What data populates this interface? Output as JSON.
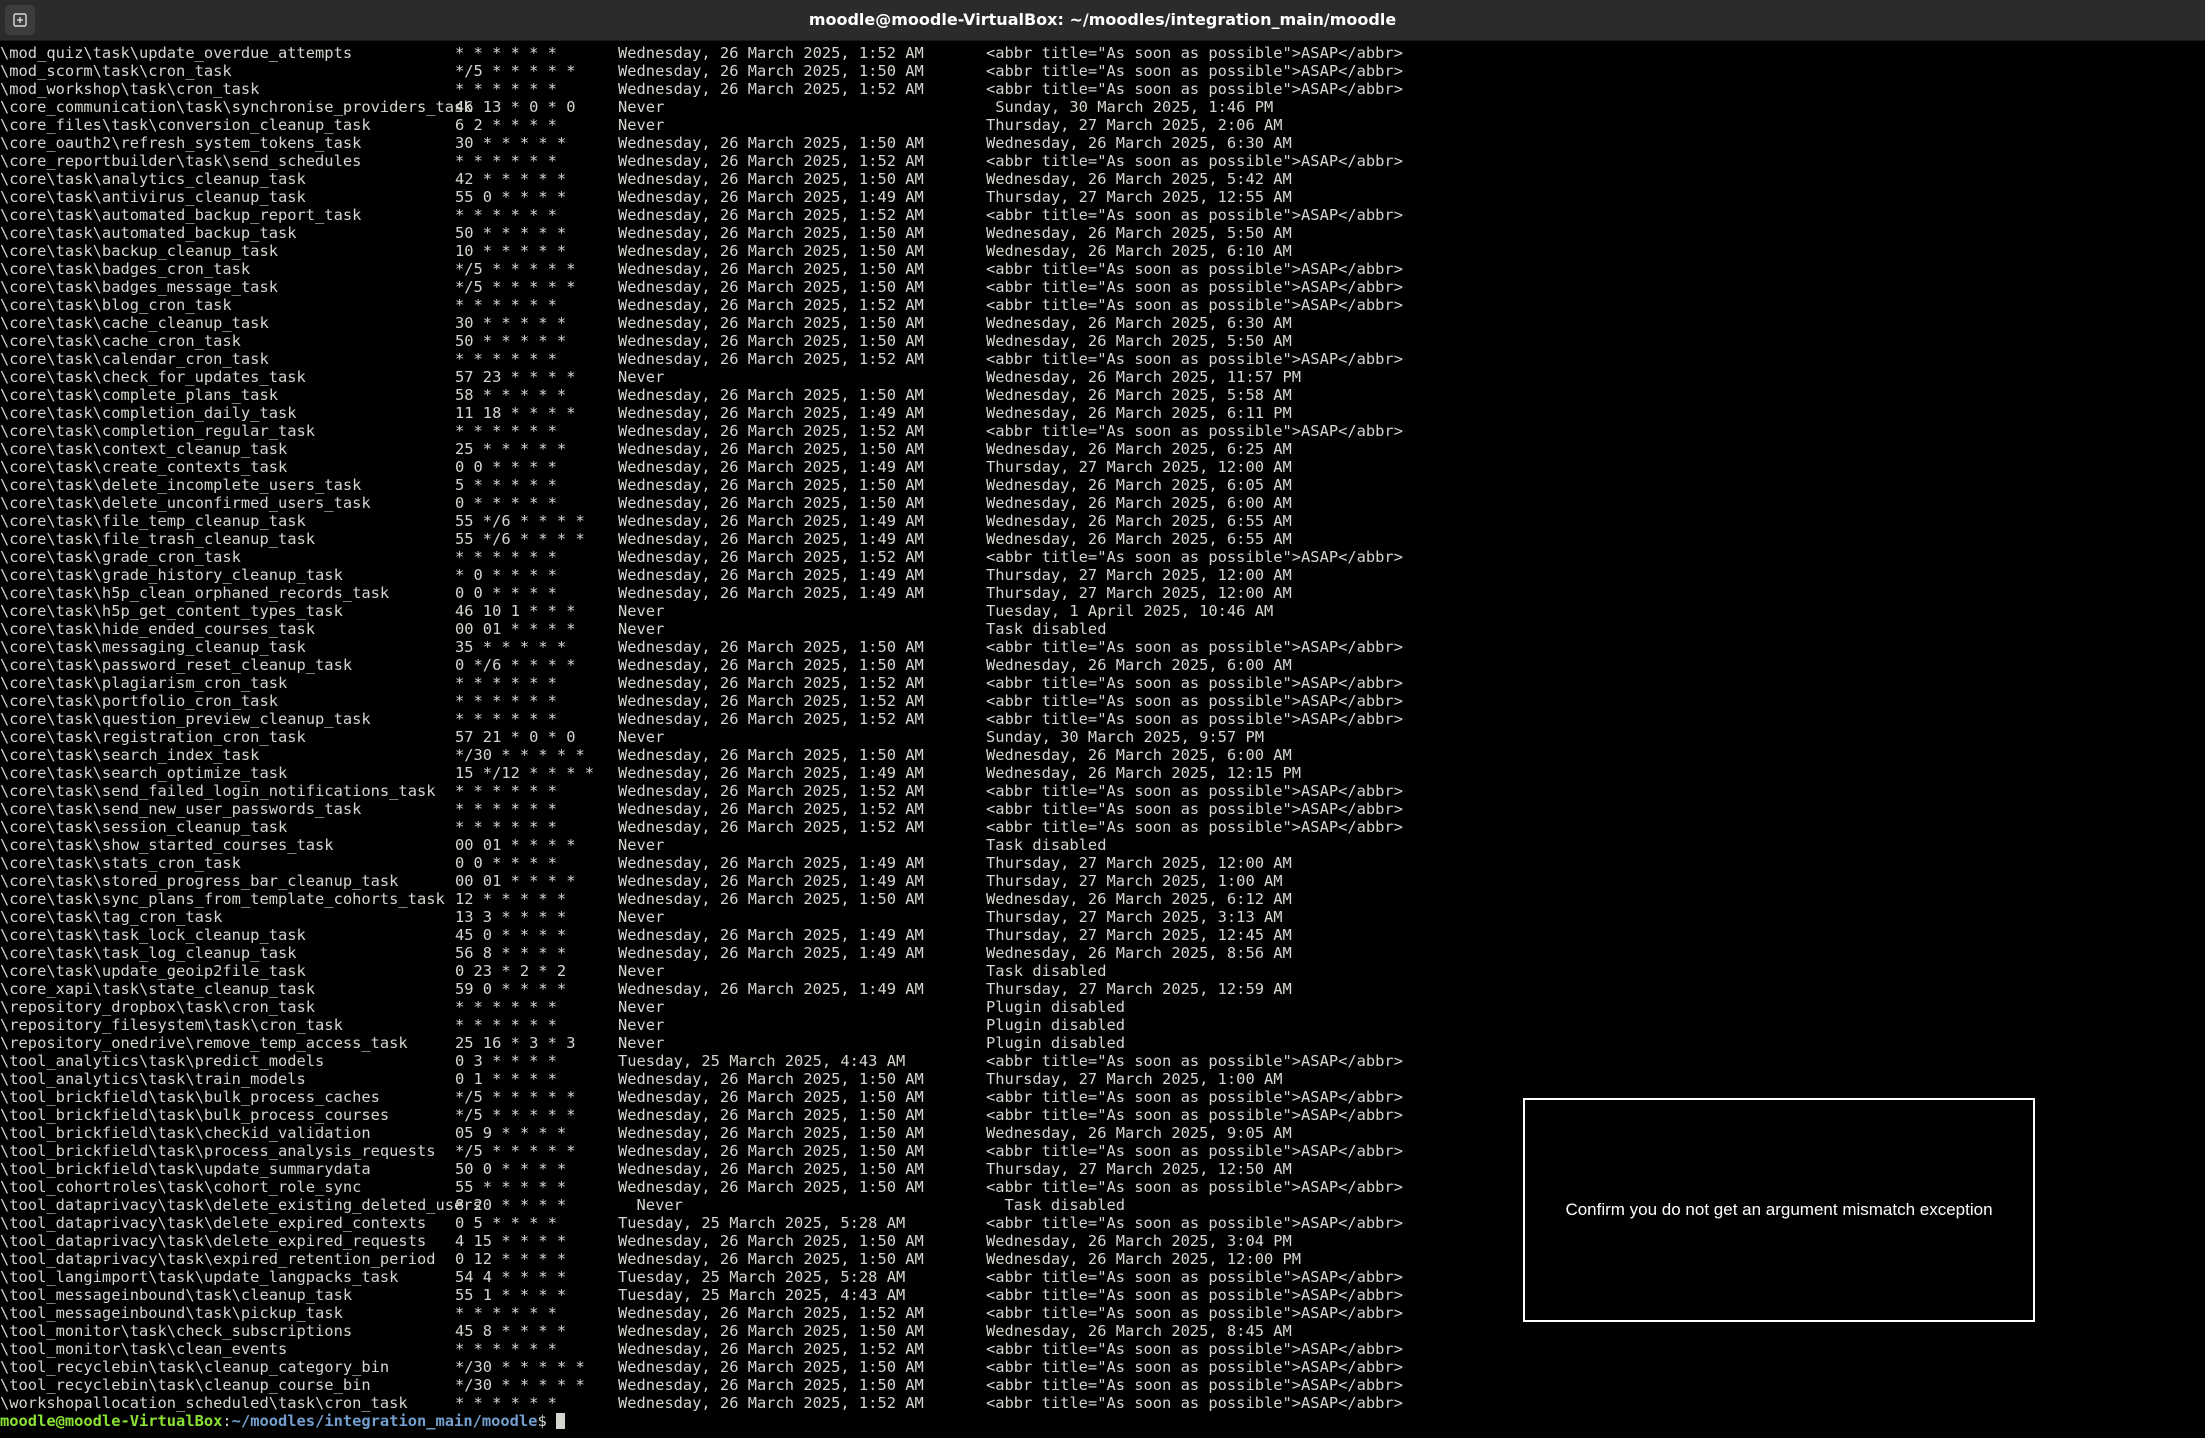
{
  "window": {
    "title": "moodle@moodle-VirtualBox: ~/moodles/integration_main/moodle",
    "new_tab_icon": "new-tab-icon"
  },
  "rows": [
    [
      "\\mod_quiz\\task\\update_overdue_attempts",
      "* * * * * *",
      "Wednesday, 26 March 2025, 1:52 AM",
      "<abbr title=\"As soon as possible\">ASAP</abbr>"
    ],
    [
      "\\mod_scorm\\task\\cron_task",
      "*/5 * * * * *",
      "Wednesday, 26 March 2025, 1:50 AM",
      "<abbr title=\"As soon as possible\">ASAP</abbr>"
    ],
    [
      "\\mod_workshop\\task\\cron_task",
      "* * * * * *",
      "Wednesday, 26 March 2025, 1:52 AM",
      "<abbr title=\"As soon as possible\">ASAP</abbr>"
    ],
    [
      "\\core_communication\\task\\synchronise_providers_task",
      "46 13 * 0 * 0",
      "Never",
      " Sunday, 30 March 2025, 1:46 PM"
    ],
    [
      "\\core_files\\task\\conversion_cleanup_task",
      "6 2 * * * *",
      "Never",
      "Thursday, 27 March 2025, 2:06 AM"
    ],
    [
      "\\core_oauth2\\refresh_system_tokens_task",
      "30 * * * * *",
      "Wednesday, 26 March 2025, 1:50 AM",
      "Wednesday, 26 March 2025, 6:30 AM"
    ],
    [
      "\\core_reportbuilder\\task\\send_schedules",
      "* * * * * *",
      "Wednesday, 26 March 2025, 1:52 AM",
      "<abbr title=\"As soon as possible\">ASAP</abbr>"
    ],
    [
      "\\core\\task\\analytics_cleanup_task",
      "42 * * * * *",
      "Wednesday, 26 March 2025, 1:50 AM",
      "Wednesday, 26 March 2025, 5:42 AM"
    ],
    [
      "\\core\\task\\antivirus_cleanup_task",
      "55 0 * * * *",
      "Wednesday, 26 March 2025, 1:49 AM",
      "Thursday, 27 March 2025, 12:55 AM"
    ],
    [
      "\\core\\task\\automated_backup_report_task",
      "* * * * * *",
      "Wednesday, 26 March 2025, 1:52 AM",
      "<abbr title=\"As soon as possible\">ASAP</abbr>"
    ],
    [
      "\\core\\task\\automated_backup_task",
      "50 * * * * *",
      "Wednesday, 26 March 2025, 1:50 AM",
      "Wednesday, 26 March 2025, 5:50 AM"
    ],
    [
      "\\core\\task\\backup_cleanup_task",
      "10 * * * * *",
      "Wednesday, 26 March 2025, 1:50 AM",
      "Wednesday, 26 March 2025, 6:10 AM"
    ],
    [
      "\\core\\task\\badges_cron_task",
      "*/5 * * * * *",
      "Wednesday, 26 March 2025, 1:50 AM",
      "<abbr title=\"As soon as possible\">ASAP</abbr>"
    ],
    [
      "\\core\\task\\badges_message_task",
      "*/5 * * * * *",
      "Wednesday, 26 March 2025, 1:50 AM",
      "<abbr title=\"As soon as possible\">ASAP</abbr>"
    ],
    [
      "\\core\\task\\blog_cron_task",
      "* * * * * *",
      "Wednesday, 26 March 2025, 1:52 AM",
      "<abbr title=\"As soon as possible\">ASAP</abbr>"
    ],
    [
      "\\core\\task\\cache_cleanup_task",
      "30 * * * * *",
      "Wednesday, 26 March 2025, 1:50 AM",
      "Wednesday, 26 March 2025, 6:30 AM"
    ],
    [
      "\\core\\task\\cache_cron_task",
      "50 * * * * *",
      "Wednesday, 26 March 2025, 1:50 AM",
      "Wednesday, 26 March 2025, 5:50 AM"
    ],
    [
      "\\core\\task\\calendar_cron_task",
      "* * * * * *",
      "Wednesday, 26 March 2025, 1:52 AM",
      "<abbr title=\"As soon as possible\">ASAP</abbr>"
    ],
    [
      "\\core\\task\\check_for_updates_task",
      "57 23 * * * *",
      "Never",
      "Wednesday, 26 March 2025, 11:57 PM"
    ],
    [
      "\\core\\task\\complete_plans_task",
      "58 * * * * *",
      "Wednesday, 26 March 2025, 1:50 AM",
      "Wednesday, 26 March 2025, 5:58 AM"
    ],
    [
      "\\core\\task\\completion_daily_task",
      "11 18 * * * *",
      "Wednesday, 26 March 2025, 1:49 AM",
      "Wednesday, 26 March 2025, 6:11 PM"
    ],
    [
      "\\core\\task\\completion_regular_task",
      "* * * * * *",
      "Wednesday, 26 March 2025, 1:52 AM",
      "<abbr title=\"As soon as possible\">ASAP</abbr>"
    ],
    [
      "\\core\\task\\context_cleanup_task",
      "25 * * * * *",
      "Wednesday, 26 March 2025, 1:50 AM",
      "Wednesday, 26 March 2025, 6:25 AM"
    ],
    [
      "\\core\\task\\create_contexts_task",
      "0 0 * * * *",
      "Wednesday, 26 March 2025, 1:49 AM",
      "Thursday, 27 March 2025, 12:00 AM"
    ],
    [
      "\\core\\task\\delete_incomplete_users_task",
      "5 * * * * *",
      "Wednesday, 26 March 2025, 1:50 AM",
      "Wednesday, 26 March 2025, 6:05 AM"
    ],
    [
      "\\core\\task\\delete_unconfirmed_users_task",
      "0 * * * * *",
      "Wednesday, 26 March 2025, 1:50 AM",
      "Wednesday, 26 March 2025, 6:00 AM"
    ],
    [
      "\\core\\task\\file_temp_cleanup_task",
      "55 */6 * * * *",
      "Wednesday, 26 March 2025, 1:49 AM",
      "Wednesday, 26 March 2025, 6:55 AM"
    ],
    [
      "\\core\\task\\file_trash_cleanup_task",
      "55 */6 * * * *",
      "Wednesday, 26 March 2025, 1:49 AM",
      "Wednesday, 26 March 2025, 6:55 AM"
    ],
    [
      "\\core\\task\\grade_cron_task",
      "* * * * * *",
      "Wednesday, 26 March 2025, 1:52 AM",
      "<abbr title=\"As soon as possible\">ASAP</abbr>"
    ],
    [
      "\\core\\task\\grade_history_cleanup_task",
      "* 0 * * * *",
      "Wednesday, 26 March 2025, 1:49 AM",
      "Thursday, 27 March 2025, 12:00 AM"
    ],
    [
      "\\core\\task\\h5p_clean_orphaned_records_task",
      "0 0 * * * *",
      "Wednesday, 26 March 2025, 1:49 AM",
      "Thursday, 27 March 2025, 12:00 AM"
    ],
    [
      "\\core\\task\\h5p_get_content_types_task",
      "46 10 1 * * *",
      "Never",
      "Tuesday, 1 April 2025, 10:46 AM"
    ],
    [
      "\\core\\task\\hide_ended_courses_task",
      "00 01 * * * *",
      "Never",
      "Task disabled"
    ],
    [
      "\\core\\task\\messaging_cleanup_task",
      "35 * * * * *",
      "Wednesday, 26 March 2025, 1:50 AM",
      "<abbr title=\"As soon as possible\">ASAP</abbr>"
    ],
    [
      "\\core\\task\\password_reset_cleanup_task",
      "0 */6 * * * *",
      "Wednesday, 26 March 2025, 1:50 AM",
      "Wednesday, 26 March 2025, 6:00 AM"
    ],
    [
      "\\core\\task\\plagiarism_cron_task",
      "* * * * * *",
      "Wednesday, 26 March 2025, 1:52 AM",
      "<abbr title=\"As soon as possible\">ASAP</abbr>"
    ],
    [
      "\\core\\task\\portfolio_cron_task",
      "* * * * * *",
      "Wednesday, 26 March 2025, 1:52 AM",
      "<abbr title=\"As soon as possible\">ASAP</abbr>"
    ],
    [
      "\\core\\task\\question_preview_cleanup_task",
      "* * * * * *",
      "Wednesday, 26 March 2025, 1:52 AM",
      "<abbr title=\"As soon as possible\">ASAP</abbr>"
    ],
    [
      "\\core\\task\\registration_cron_task",
      "57 21 * 0 * 0",
      "Never",
      "Sunday, 30 March 2025, 9:57 PM"
    ],
    [
      "\\core\\task\\search_index_task",
      "*/30 * * * * *",
      "Wednesday, 26 March 2025, 1:50 AM",
      "Wednesday, 26 March 2025, 6:00 AM"
    ],
    [
      "\\core\\task\\search_optimize_task",
      "15 */12 * * * *",
      "Wednesday, 26 March 2025, 1:49 AM",
      "Wednesday, 26 March 2025, 12:15 PM"
    ],
    [
      "\\core\\task\\send_failed_login_notifications_task",
      "* * * * * *",
      "Wednesday, 26 March 2025, 1:52 AM",
      "<abbr title=\"As soon as possible\">ASAP</abbr>"
    ],
    [
      "\\core\\task\\send_new_user_passwords_task",
      "* * * * * *",
      "Wednesday, 26 March 2025, 1:52 AM",
      "<abbr title=\"As soon as possible\">ASAP</abbr>"
    ],
    [
      "\\core\\task\\session_cleanup_task",
      "* * * * * *",
      "Wednesday, 26 March 2025, 1:52 AM",
      "<abbr title=\"As soon as possible\">ASAP</abbr>"
    ],
    [
      "\\core\\task\\show_started_courses_task",
      "00 01 * * * *",
      "Never",
      "Task disabled"
    ],
    [
      "\\core\\task\\stats_cron_task",
      "0 0 * * * *",
      "Wednesday, 26 March 2025, 1:49 AM",
      "Thursday, 27 March 2025, 12:00 AM"
    ],
    [
      "\\core\\task\\stored_progress_bar_cleanup_task",
      "00 01 * * * *",
      "Wednesday, 26 March 2025, 1:49 AM",
      "Thursday, 27 March 2025, 1:00 AM"
    ],
    [
      "\\core\\task\\sync_plans_from_template_cohorts_task",
      "12 * * * * *",
      "Wednesday, 26 March 2025, 1:50 AM",
      "Wednesday, 26 March 2025, 6:12 AM"
    ],
    [
      "\\core\\task\\tag_cron_task",
      "13 3 * * * *",
      "Never",
      "Thursday, 27 March 2025, 3:13 AM"
    ],
    [
      "\\core\\task\\task_lock_cleanup_task",
      "45 0 * * * *",
      "Wednesday, 26 March 2025, 1:49 AM",
      "Thursday, 27 March 2025, 12:45 AM"
    ],
    [
      "\\core\\task\\task_log_cleanup_task",
      "56 8 * * * *",
      "Wednesday, 26 March 2025, 1:49 AM",
      "Wednesday, 26 March 2025, 8:56 AM"
    ],
    [
      "\\core\\task\\update_geoip2file_task",
      "0 23 * 2 * 2",
      "Never",
      "Task disabled"
    ],
    [
      "\\core_xapi\\task\\state_cleanup_task",
      "59 0 * * * *",
      "Wednesday, 26 March 2025, 1:49 AM",
      "Thursday, 27 March 2025, 12:59 AM"
    ],
    [
      "\\repository_dropbox\\task\\cron_task",
      "* * * * * *",
      "Never",
      "Plugin disabled"
    ],
    [
      "\\repository_filesystem\\task\\cron_task",
      "* * * * * *",
      "Never",
      "Plugin disabled"
    ],
    [
      "\\repository_onedrive\\remove_temp_access_task",
      "25 16 * 3 * 3",
      "Never",
      "Plugin disabled"
    ],
    [
      "\\tool_analytics\\task\\predict_models",
      "0 3 * * * *",
      "Tuesday, 25 March 2025, 4:43 AM",
      "<abbr title=\"As soon as possible\">ASAP</abbr>"
    ],
    [
      "\\tool_analytics\\task\\train_models",
      "0 1 * * * *",
      "Wednesday, 26 March 2025, 1:50 AM",
      "Thursday, 27 March 2025, 1:00 AM"
    ],
    [
      "\\tool_brickfield\\task\\bulk_process_caches",
      "*/5 * * * * *",
      "Wednesday, 26 March 2025, 1:50 AM",
      "<abbr title=\"As soon as possible\">ASAP</abbr>"
    ],
    [
      "\\tool_brickfield\\task\\bulk_process_courses",
      "*/5 * * * * *",
      "Wednesday, 26 March 2025, 1:50 AM",
      "<abbr title=\"As soon as possible\">ASAP</abbr>"
    ],
    [
      "\\tool_brickfield\\task\\checkid_validation",
      "05 9 * * * *",
      "Wednesday, 26 March 2025, 1:50 AM",
      "Wednesday, 26 March 2025, 9:05 AM"
    ],
    [
      "\\tool_brickfield\\task\\process_analysis_requests",
      "*/5 * * * * *",
      "Wednesday, 26 March 2025, 1:50 AM",
      "<abbr title=\"As soon as possible\">ASAP</abbr>"
    ],
    [
      "\\tool_brickfield\\task\\update_summarydata",
      "50 0 * * * *",
      "Wednesday, 26 March 2025, 1:50 AM",
      "Thursday, 27 March 2025, 12:50 AM"
    ],
    [
      "\\tool_cohortroles\\task\\cohort_role_sync",
      "55 * * * * *",
      "Wednesday, 26 March 2025, 1:50 AM",
      "<abbr title=\"As soon as possible\">ASAP</abbr>"
    ],
    [
      "\\tool_dataprivacy\\task\\delete_existing_deleted_users",
      "8 20 * * * *",
      "  Never",
      "  Task disabled"
    ],
    [
      "\\tool_dataprivacy\\task\\delete_expired_contexts",
      "0 5 * * * *",
      "Tuesday, 25 March 2025, 5:28 AM",
      "<abbr title=\"As soon as possible\">ASAP</abbr>"
    ],
    [
      "\\tool_dataprivacy\\task\\delete_expired_requests",
      "4 15 * * * *",
      "Wednesday, 26 March 2025, 1:50 AM",
      "Wednesday, 26 March 2025, 3:04 PM"
    ],
    [
      "\\tool_dataprivacy\\task\\expired_retention_period",
      "0 12 * * * *",
      "Wednesday, 26 March 2025, 1:50 AM",
      "Wednesday, 26 March 2025, 12:00 PM"
    ],
    [
      "\\tool_langimport\\task\\update_langpacks_task",
      "54 4 * * * *",
      "Tuesday, 25 March 2025, 5:28 AM",
      "<abbr title=\"As soon as possible\">ASAP</abbr>"
    ],
    [
      "\\tool_messageinbound\\task\\cleanup_task",
      "55 1 * * * *",
      "Tuesday, 25 March 2025, 4:43 AM",
      "<abbr title=\"As soon as possible\">ASAP</abbr>"
    ],
    [
      "\\tool_messageinbound\\task\\pickup_task",
      "* * * * * *",
      "Wednesday, 26 March 2025, 1:52 AM",
      "<abbr title=\"As soon as possible\">ASAP</abbr>"
    ],
    [
      "\\tool_monitor\\task\\check_subscriptions",
      "45 8 * * * *",
      "Wednesday, 26 March 2025, 1:50 AM",
      "Wednesday, 26 March 2025, 8:45 AM"
    ],
    [
      "\\tool_monitor\\task\\clean_events",
      "* * * * * *",
      "Wednesday, 26 March 2025, 1:52 AM",
      "<abbr title=\"As soon as possible\">ASAP</abbr>"
    ],
    [
      "\\tool_recyclebin\\task\\cleanup_category_bin",
      "*/30 * * * * *",
      "Wednesday, 26 March 2025, 1:50 AM",
      "<abbr title=\"As soon as possible\">ASAP</abbr>"
    ],
    [
      "\\tool_recyclebin\\task\\cleanup_course_bin",
      "*/30 * * * * *",
      "Wednesday, 26 March 2025, 1:50 AM",
      "<abbr title=\"As soon as possible\">ASAP</abbr>"
    ],
    [
      "\\workshopallocation_scheduled\\task\\cron_task",
      "* * * * * *",
      "Wednesday, 26 March 2025, 1:52 AM",
      "<abbr title=\"As soon as possible\">ASAP</abbr>"
    ]
  ],
  "prompt": {
    "user_host": "moodle@moodle-VirtualBox",
    "sep": ":",
    "path": "~/moodles/integration_main/moodle",
    "symbol": "$ "
  },
  "overlay": {
    "text": "Confirm you do not get an argument mismatch exception"
  }
}
